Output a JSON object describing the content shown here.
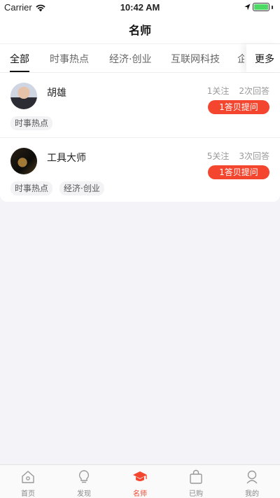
{
  "status_bar": {
    "carrier": "Carrier",
    "time": "10:42 AM"
  },
  "nav": {
    "title": "名师"
  },
  "tabs": {
    "items": [
      "全部",
      "时事热点",
      "经济·创业",
      "互联网科技"
    ],
    "overflow": "企",
    "more": "更多",
    "active_index": 0
  },
  "teachers": [
    {
      "name": "胡雄",
      "follows": "1关注",
      "answers": "2次回答",
      "ask_label": "1答贝提问",
      "tags": [
        "时事热点"
      ]
    },
    {
      "name": "工具大师",
      "follows": "5关注",
      "answers": "3次回答",
      "ask_label": "1答贝提问",
      "tags": [
        "时事热点",
        "经济·创业"
      ]
    }
  ],
  "tab_bar": {
    "items": [
      {
        "label": "首页",
        "icon": "home-icon"
      },
      {
        "label": "发现",
        "icon": "lightbulb-icon"
      },
      {
        "label": "名师",
        "icon": "graduation-cap-icon"
      },
      {
        "label": "已购",
        "icon": "shopping-bag-icon"
      },
      {
        "label": "我的",
        "icon": "profile-icon"
      }
    ],
    "active_index": 2
  },
  "colors": {
    "accent": "#f4462e",
    "battery": "#4cd964"
  }
}
